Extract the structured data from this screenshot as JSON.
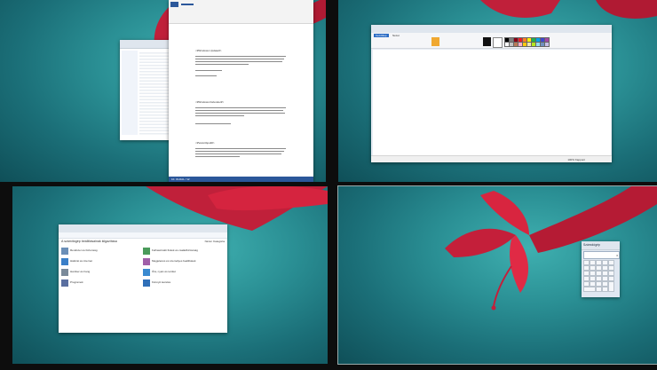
{
  "word": {
    "heading1": "<#Windows Update#>",
    "heading2": "<#Windows Defender#>",
    "heading3": "<#Vezérlőpult#>",
    "statusbar": "10. OLDAL / 12"
  },
  "paint": {
    "tab_home": "Kezdőlap",
    "tab_view": "Nézet",
    "statusbar": "100%  Képpont"
  },
  "control_panel": {
    "heading": "A számítógép beállításainak kiigazítása",
    "view_by": "Nézet: Kategória",
    "categories": [
      "Rendszer és biztonság",
      "Hálózat és internet",
      "Hardver és hang",
      "Programok",
      "Felhasználói fiókok és családbiztonság",
      "Megjelenés és személyes beállítások",
      "Óra, nyelv és terület",
      "Könnyű kezelés"
    ]
  },
  "calculator": {
    "title": "Számológép",
    "display": "0",
    "menu": [
      "Nézet",
      "Szerkesztés",
      "Súgó"
    ]
  }
}
